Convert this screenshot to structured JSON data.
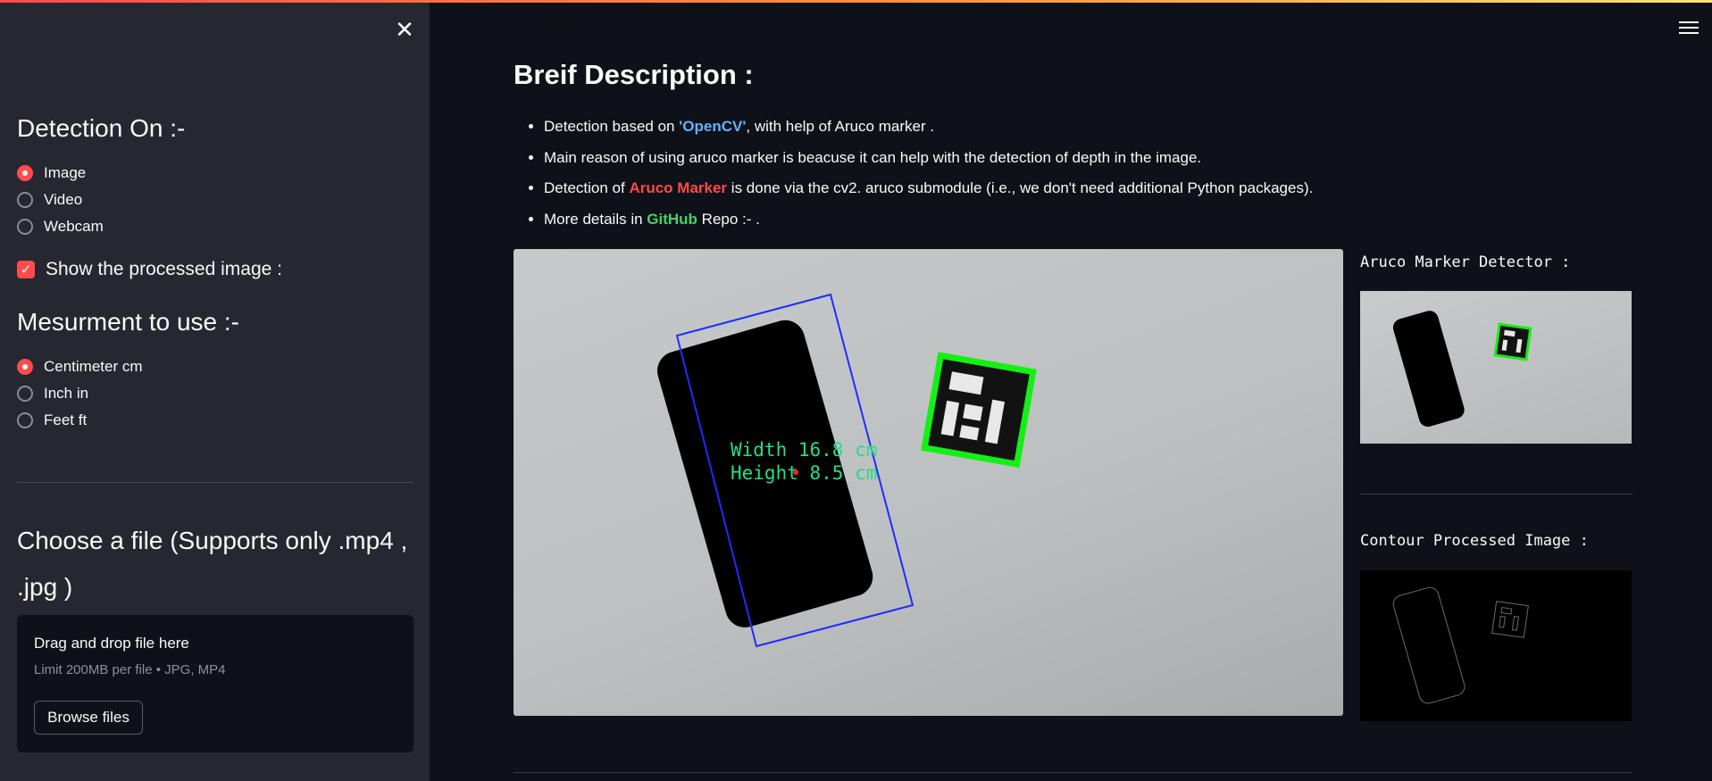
{
  "sidebar": {
    "close_icon": "close-icon",
    "detection_heading": "Detection On :-",
    "detection_options": [
      "Image",
      "Video",
      "Webcam"
    ],
    "detection_selected": "Image",
    "show_processed_label": "Show the processed image :",
    "show_processed_checked": true,
    "measurement_heading": "Mesurment to use :-",
    "measurement_options": [
      "Centimeter cm",
      "Inch in",
      "Feet ft"
    ],
    "measurement_selected": "Centimeter cm",
    "file_heading": "Choose a file (Supports only .mp4 , .jpg )",
    "dropzone": {
      "title": "Drag and drop file here",
      "limit": "Limit 200MB per file • JPG, MP4",
      "browse_label": "Browse files"
    }
  },
  "header": {
    "menu_icon": "hamburger-menu-icon",
    "accent_gradient": [
      "#ff4b4b",
      "#ffe17a"
    ]
  },
  "main": {
    "title": "Breif Description :",
    "bullets": {
      "b1": {
        "pre": "Detection based on ",
        "highlight": "'OpenCV'",
        "post": ", with help of Aruco marker ."
      },
      "b2": {
        "text": "Main reason of using aruco marker is beacuse it can help with the detection of depth in the image."
      },
      "b3": {
        "pre": "Detection of ",
        "highlight": "Aruco Marker",
        "post": " is done via the cv2. aruco submodule (i.e., we don't need additional Python packages)."
      },
      "b4": {
        "pre": "More details in ",
        "highlight": "GitHub",
        "post": " Repo :- ."
      }
    },
    "image_overlay": {
      "width_text": "Width 16.8 cm",
      "height_text": "Height 8.5 cm"
    },
    "side_panel": {
      "aruco_label": "Aruco Marker Detector :",
      "contour_label": "Contour Processed Image :"
    }
  },
  "colors": {
    "accent": "#ff4b4b",
    "link_blue": "#60b4ff",
    "link_green": "#3dd56d",
    "sidebar_bg": "#262730",
    "main_bg": "#0e1117"
  }
}
